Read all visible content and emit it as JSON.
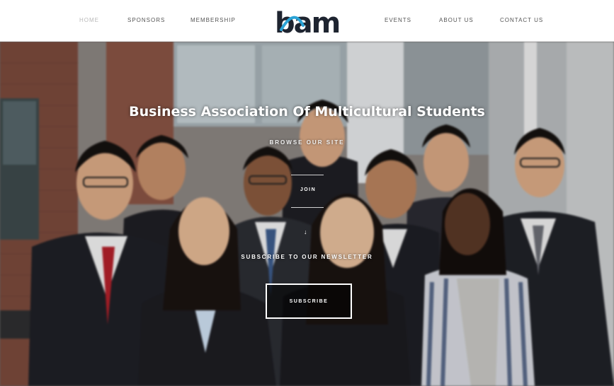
{
  "nav": {
    "left": [
      "HOME",
      "SPONSORS",
      "MEMBERSHIP"
    ],
    "right": [
      "EVENTS",
      "ABOUT US",
      "CONTACT US"
    ],
    "logo_text": "bam"
  },
  "hero": {
    "title": "Business Association Of Multicultural Students",
    "subtitle": "BROWSE OUR SITE",
    "link_label": "JOIN",
    "arrow": "↓",
    "newsletter_label": "SUBSCRIBE TO OUR NEWSLETTER",
    "subscribe_label": "SUBSCRIBE"
  },
  "colors": {
    "logo_dark": "#1e2430",
    "logo_accent": "#2aa3d6",
    "brick": "#7b4a3c",
    "suit": "#1f1f24"
  }
}
